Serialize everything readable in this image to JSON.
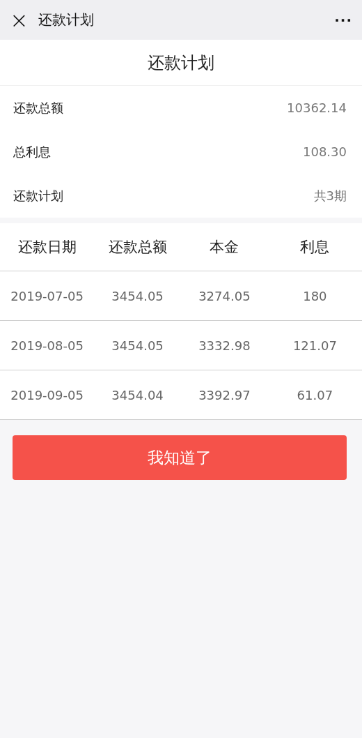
{
  "nav_bar": {
    "close": "×",
    "title": "还款计划",
    "more": "···"
  },
  "page_title": "还款计划",
  "summary": [
    {
      "label": "还款总额",
      "value": "10362.14"
    },
    {
      "label": "总利息",
      "value": "108.30"
    },
    {
      "label": "还款计划",
      "value": "共3期"
    }
  ],
  "table": {
    "columns": [
      "还款日期",
      "还款总额",
      "本金",
      "利息"
    ],
    "rows": [
      [
        "2019-07-05",
        "3454.05",
        "3274.05",
        "180"
      ],
      [
        "2019-08-05",
        "3454.05",
        "3332.98",
        "121.07"
      ],
      [
        "2019-09-05",
        "3454.04",
        "3392.97",
        "61.07"
      ]
    ]
  },
  "button": "我知道了"
}
